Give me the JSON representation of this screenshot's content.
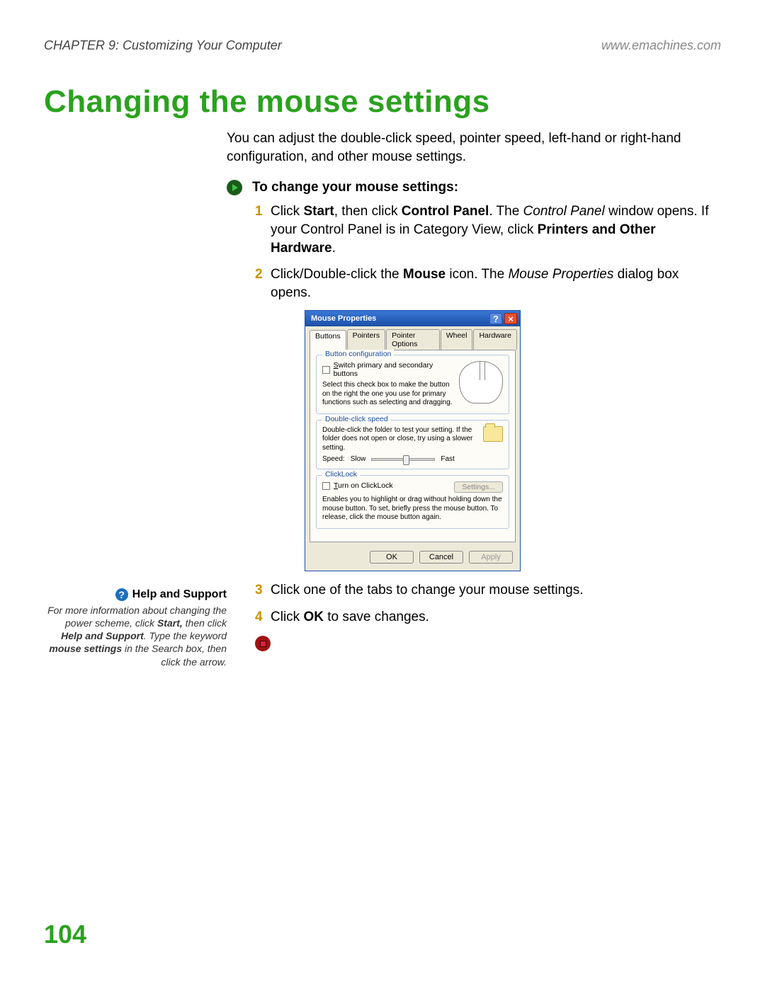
{
  "header": {
    "left": "CHAPTER 9: Customizing Your Computer",
    "right": "www.emachines.com"
  },
  "title": "Changing the mouse settings",
  "intro": "You can adjust the double-click speed, pointer speed, left-hand or right-hand configuration, and other mouse settings.",
  "procedure_heading": "To change your mouse settings:",
  "steps": {
    "s1": {
      "num": "1",
      "pre": "Click ",
      "b1": "Start",
      "mid1": ", then click ",
      "b2": "Control Panel",
      "mid2": ". The ",
      "i1": "Control Panel",
      "mid3": " window opens. If your Control Panel is in Category View, click ",
      "b3": "Printers and Other Hardware",
      "post": "."
    },
    "s2": {
      "num": "2",
      "pre": "Click/Double-click the ",
      "b1": "Mouse",
      "mid1": " icon. The ",
      "i1": "Mouse Properties",
      "post": " dialog box opens."
    },
    "s3": {
      "num": "3",
      "text": "Click one of the tabs to change your mouse settings."
    },
    "s4": {
      "num": "4",
      "pre": "Click ",
      "b1": "OK",
      "post": " to save changes."
    }
  },
  "dialog": {
    "title": "Mouse Properties",
    "tabs": [
      "Buttons",
      "Pointers",
      "Pointer Options",
      "Wheel",
      "Hardware"
    ],
    "group1": {
      "title": "Button configuration",
      "chk_pre_u": "S",
      "chk_rest": "witch primary and secondary buttons",
      "desc": "Select this check box to make the button on the right the one you use for primary functions such as selecting and dragging."
    },
    "group2": {
      "title": "Double-click speed",
      "desc": "Double-click the folder to test your setting. If the folder does not open or close, try using a slower setting.",
      "speed_label": "Speed:",
      "slow": "Slow",
      "fast": "Fast"
    },
    "group3": {
      "title": "ClickLock",
      "chk_pre_u": "T",
      "chk_rest": "urn on ClickLock",
      "settings_btn": "Settings...",
      "desc": "Enables you to highlight or drag without holding down the mouse button. To set, briefly press the mouse button. To release, click the mouse button again."
    },
    "buttons": {
      "ok": "OK",
      "cancel": "Cancel",
      "apply": "Apply"
    }
  },
  "help": {
    "title": "Help and Support",
    "l1": "For more information about changing the power scheme, click ",
    "b1": "Start,",
    "l2": " then click ",
    "b2": "Help and Support",
    "l3": ". Type the keyword ",
    "b3": "mouse settings",
    "l4": " in the Search box, then click the arrow."
  },
  "page_number": "104"
}
